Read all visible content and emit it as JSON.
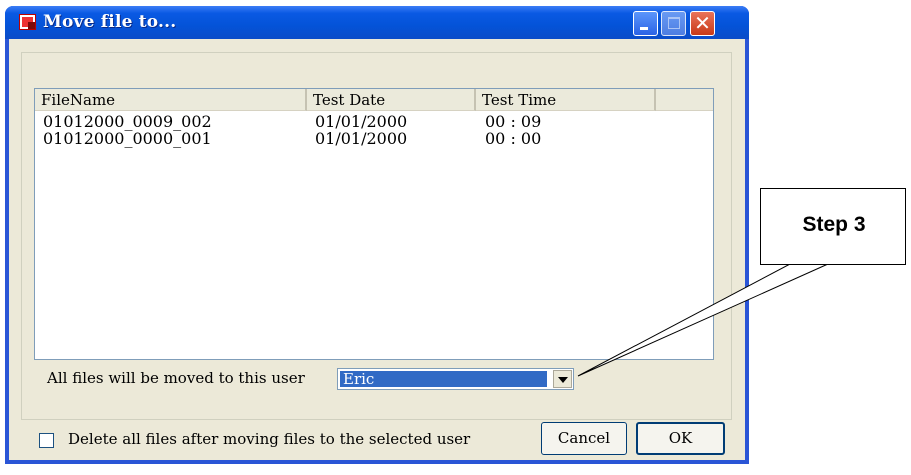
{
  "window": {
    "title": "Move file to...",
    "close_glyph": "✕"
  },
  "list": {
    "columns": [
      "FileName",
      "Test Date",
      "Test Time",
      ""
    ],
    "rows": [
      {
        "filename": "01012000_0009_002",
        "test_date": "01/01/2000",
        "test_time": "00 : 09"
      },
      {
        "filename": "01012000_0000_001",
        "test_date": "01/01/2000",
        "test_time": "00 : 00"
      }
    ]
  },
  "user_select": {
    "label": "All files will be moved to this user",
    "value": "Eric"
  },
  "delete_option": {
    "label": "Delete all files after moving files to the selected user",
    "checked": false
  },
  "buttons": {
    "cancel": "Cancel",
    "ok": "OK"
  },
  "callout": {
    "text": "Step 3"
  },
  "colors": {
    "titlebar": "#0453d8",
    "selection": "#316ac5",
    "dialog_bg": "#ece9d8"
  }
}
